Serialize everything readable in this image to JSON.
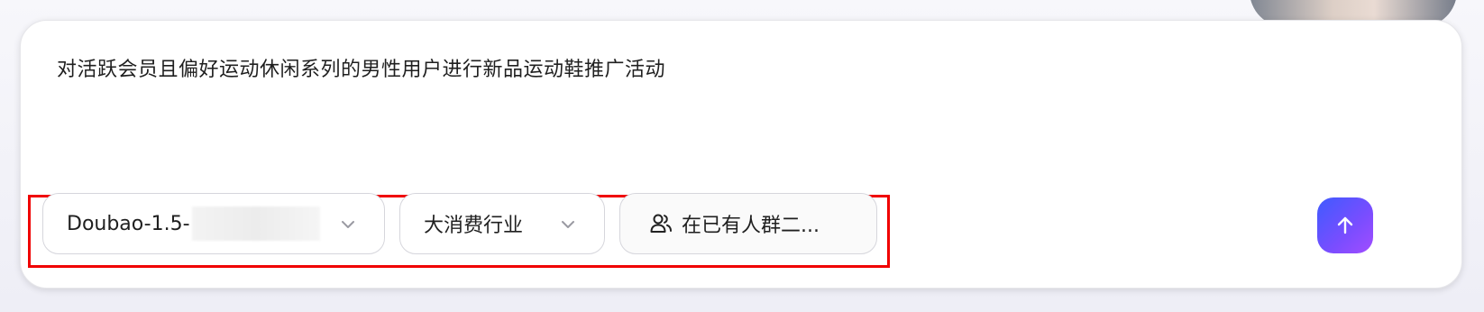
{
  "prompt": {
    "text": "对活跃会员且偏好运动休闲系列的男性用户进行新品运动鞋推广活动"
  },
  "options": {
    "model_label": "Doubao-1.5-",
    "industry_label": "大消费行业",
    "audience_label": "在已有人群二..."
  },
  "icons": {
    "model_chevron": "chevron-down-icon",
    "industry_chevron": "chevron-down-icon",
    "audience": "users-icon",
    "send": "arrow-up-icon"
  },
  "colors": {
    "highlight": "#f00000",
    "send_gradient_start": "#3f5bff",
    "send_gradient_end": "#a24dff"
  }
}
